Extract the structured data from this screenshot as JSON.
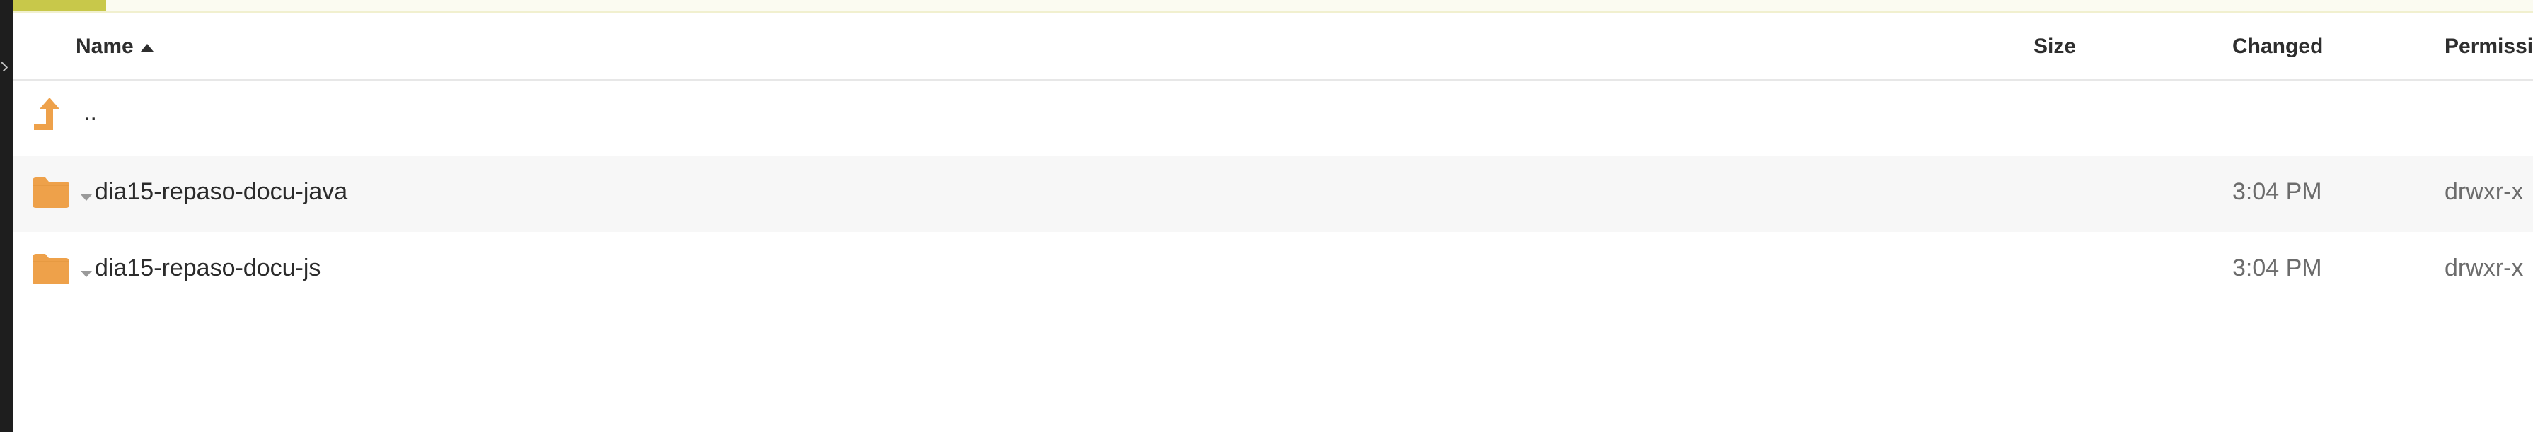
{
  "loading": {
    "progress": 0.037,
    "color": "#c8c84a"
  },
  "columns": {
    "name": "Name",
    "size": "Size",
    "changed": "Changed",
    "permissions": "Permissi"
  },
  "sort": {
    "column": "Name",
    "direction": "ascending"
  },
  "parent_entry": {
    "name": "..",
    "icon": "parent-directory-icon"
  },
  "files": [
    {
      "name": "dia15-repaso-docu-java",
      "type": "folder",
      "icon": "folder-icon",
      "size": "",
      "changed": "3:04 PM",
      "permissions": "drwxr-x"
    },
    {
      "name": "dia15-repaso-docu-js",
      "type": "folder",
      "icon": "folder-icon",
      "size": "",
      "changed": "3:04 PM",
      "permissions": "drwxr-x"
    }
  ],
  "colors": {
    "folder": "#eea14a",
    "row_alt": "#f7f7f7",
    "header_text": "#2e2e2e",
    "meta_text": "#6c6c6c"
  }
}
